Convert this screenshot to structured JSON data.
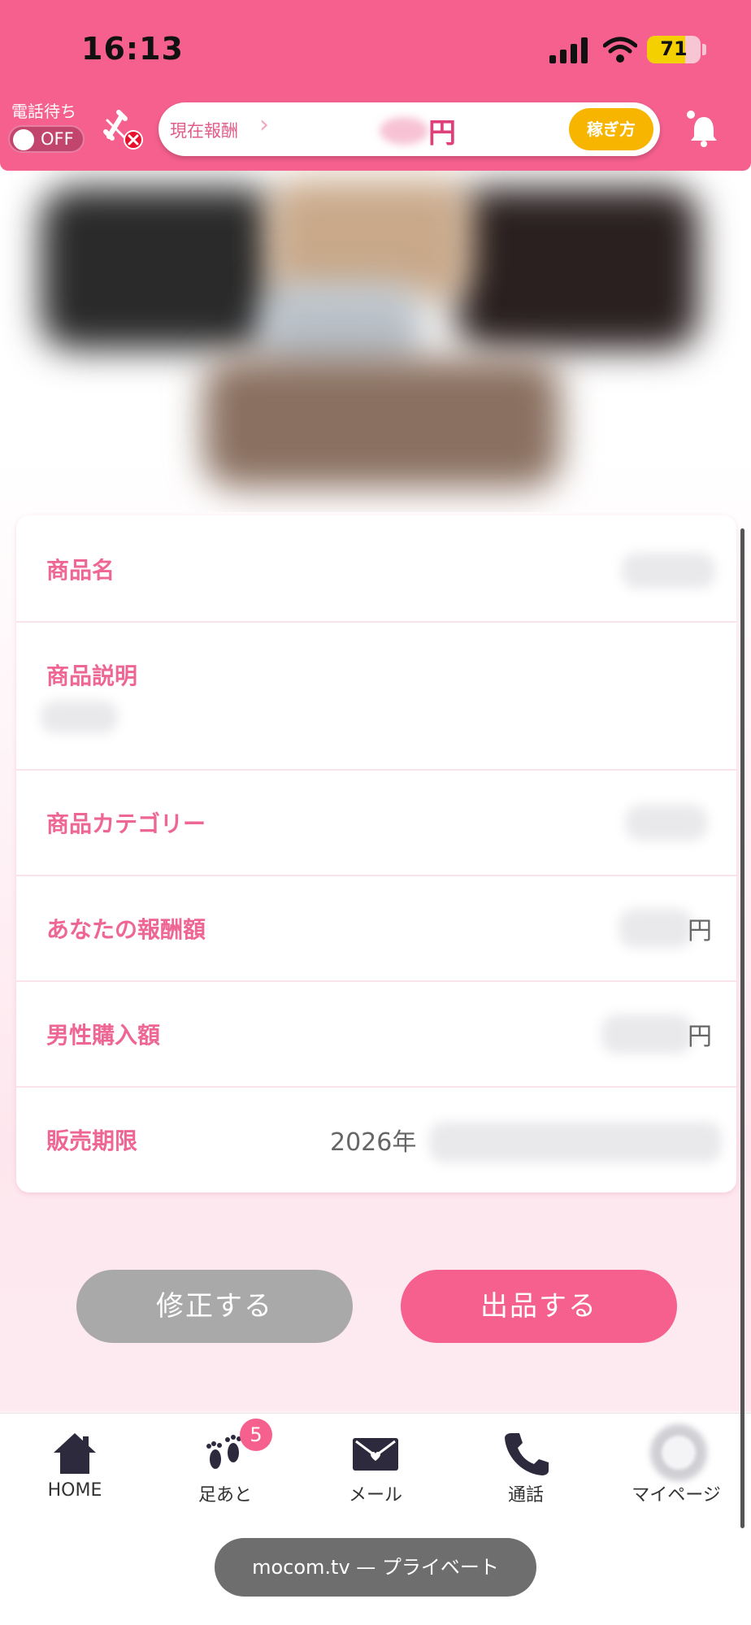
{
  "status_bar": {
    "time": "16:13",
    "battery": "71",
    "battery_level": 0.71
  },
  "header": {
    "wait_label": "電話待ち",
    "toggle_state": "OFF",
    "earnings_label": "現在報酬",
    "earnings_unit": "円",
    "howto_button": "稼ぎ方"
  },
  "product": {
    "rows": [
      {
        "label": "商品名"
      },
      {
        "label": "商品説明"
      },
      {
        "label": "商品カテゴリー"
      },
      {
        "label": "あなたの報酬額",
        "unit": "円"
      },
      {
        "label": "男性購入額",
        "unit": "円"
      },
      {
        "label": "販売期限",
        "value_prefix": "2026年"
      }
    ]
  },
  "actions": {
    "edit": "修正する",
    "list": "出品する"
  },
  "tabbar": {
    "items": [
      {
        "label": "HOME",
        "icon": "home-icon"
      },
      {
        "label": "足あと",
        "icon": "footprints-icon",
        "badge": "5"
      },
      {
        "label": "メール",
        "icon": "mail-icon"
      },
      {
        "label": "通話",
        "icon": "phone-icon"
      },
      {
        "label": "マイページ",
        "icon": "avatar-icon"
      }
    ]
  },
  "browser": {
    "url_label": "mocom.tv — プライベート"
  },
  "colors": {
    "primary": "#f5608e",
    "accent": "#f7b500",
    "label": "#ee6694"
  }
}
